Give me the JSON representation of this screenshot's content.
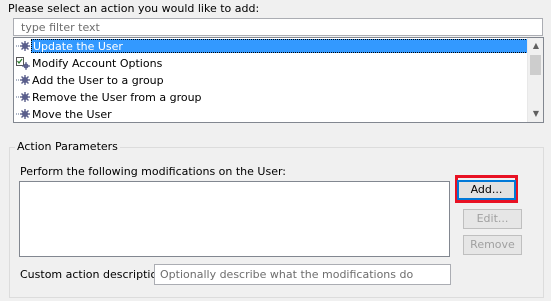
{
  "prompt_label": "Please select an action you would like to add:",
  "filter": {
    "placeholder": "type filter text",
    "value": ""
  },
  "actions": [
    {
      "label": "Update the User",
      "icon": "gear-icon",
      "selected": true
    },
    {
      "label": "Modify Account Options",
      "icon": "checklist-gear-icon",
      "selected": false
    },
    {
      "label": "Add the User to a group",
      "icon": "gear-icon",
      "selected": false
    },
    {
      "label": "Remove the User from a group",
      "icon": "gear-icon",
      "selected": false
    },
    {
      "label": "Move the User",
      "icon": "gear-icon",
      "selected": false
    }
  ],
  "action_parameters": {
    "group_title": "Action Parameters",
    "modifications_label": "Perform the following modifications on the User:",
    "buttons": {
      "add": "Add...",
      "edit": "Edit...",
      "remove": "Remove"
    },
    "custom_desc_label": "Custom action description:",
    "custom_desc_placeholder": "Optionally describe what the modifications do"
  },
  "colors": {
    "selection": "#3399ff",
    "highlight_border": "#e81123"
  }
}
